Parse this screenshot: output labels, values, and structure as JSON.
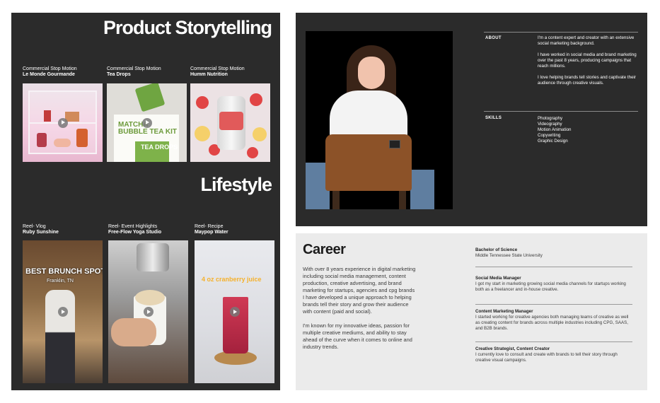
{
  "portfolio": {
    "product_heading": "Product Storytelling",
    "lifestyle_heading": "Lifestyle",
    "product_tiles": [
      {
        "category": "Commercial Stop Motion",
        "title": "Le Monde Gourmande"
      },
      {
        "category": "Commercial Stop Motion",
        "title": "Tea Drops"
      },
      {
        "category": "Commercial Stop Motion",
        "title": "Humm Nutrition"
      }
    ],
    "product_images": {
      "tea_kit_text": "MATCHA BUBBLE TEA KIT",
      "tea_drops_text": "TEA DROPS"
    },
    "lifestyle_tiles": [
      {
        "category": "Reel- Vlog",
        "title": "Ruby Sunshine",
        "overlay": "BEST BRUNCH SPOT",
        "overlay_sub": "Franklin, TN"
      },
      {
        "category": "Reel- Event Highlights",
        "title": "Free-Flow Yoga Studio"
      },
      {
        "category": "Reel- Recipe",
        "title": "Maypop Water",
        "overlay": "4 oz cranberry juice"
      }
    ]
  },
  "about": {
    "label": "ABOUT",
    "paragraphs": [
      "I'm a content expert and creator with an extensive social marketing background.",
      "I have worked in social media and brand marketing over the past 8 years, producing campaigns that reach millions.",
      "I love helping brands tell stories and captivate their audience through creative visuals."
    ],
    "skills_label": "SKILLS",
    "skills": [
      "Photography",
      "Videography",
      "Motion Animation",
      "Copywriting",
      "Graphic Design"
    ]
  },
  "career": {
    "title": "Career",
    "intro": [
      "With over 8 years experience in digital marketing including social media management, content production, creative advertising, and brand marketing for startups, agencies and cpg brands I have developed a unique approach to helping brands tell their story and grow their audience with content (paid and social).",
      "I'm known for my innovative ideas, passion for multiple creative mediums, and ability to stay ahead of the curve when it comes to online and industry trends."
    ],
    "items": [
      {
        "title": "Bachelor of Science",
        "desc": "Middle Tennessee State University"
      },
      {
        "title": "Social Media Manager",
        "desc": "I got my start in marketing growing social media channels for startups working both as a freelancer and in-house creative."
      },
      {
        "title": "Content Marketing Manager",
        "desc": "I started working for creative agencies both managing teams of creative as well as creating content for brands across multiple industries including CPG, SAAS, and B2B brands."
      },
      {
        "title": "Creative Strategist, Content Creator",
        "desc": "I currently love to consult and create with brands to tell their story through creative visual campaigns."
      }
    ]
  },
  "colors": {
    "dark_panel": "#2b2b2b",
    "light_panel": "#ebebeb",
    "text_light": "#ffffff",
    "text_dark": "#1c1c1c"
  }
}
